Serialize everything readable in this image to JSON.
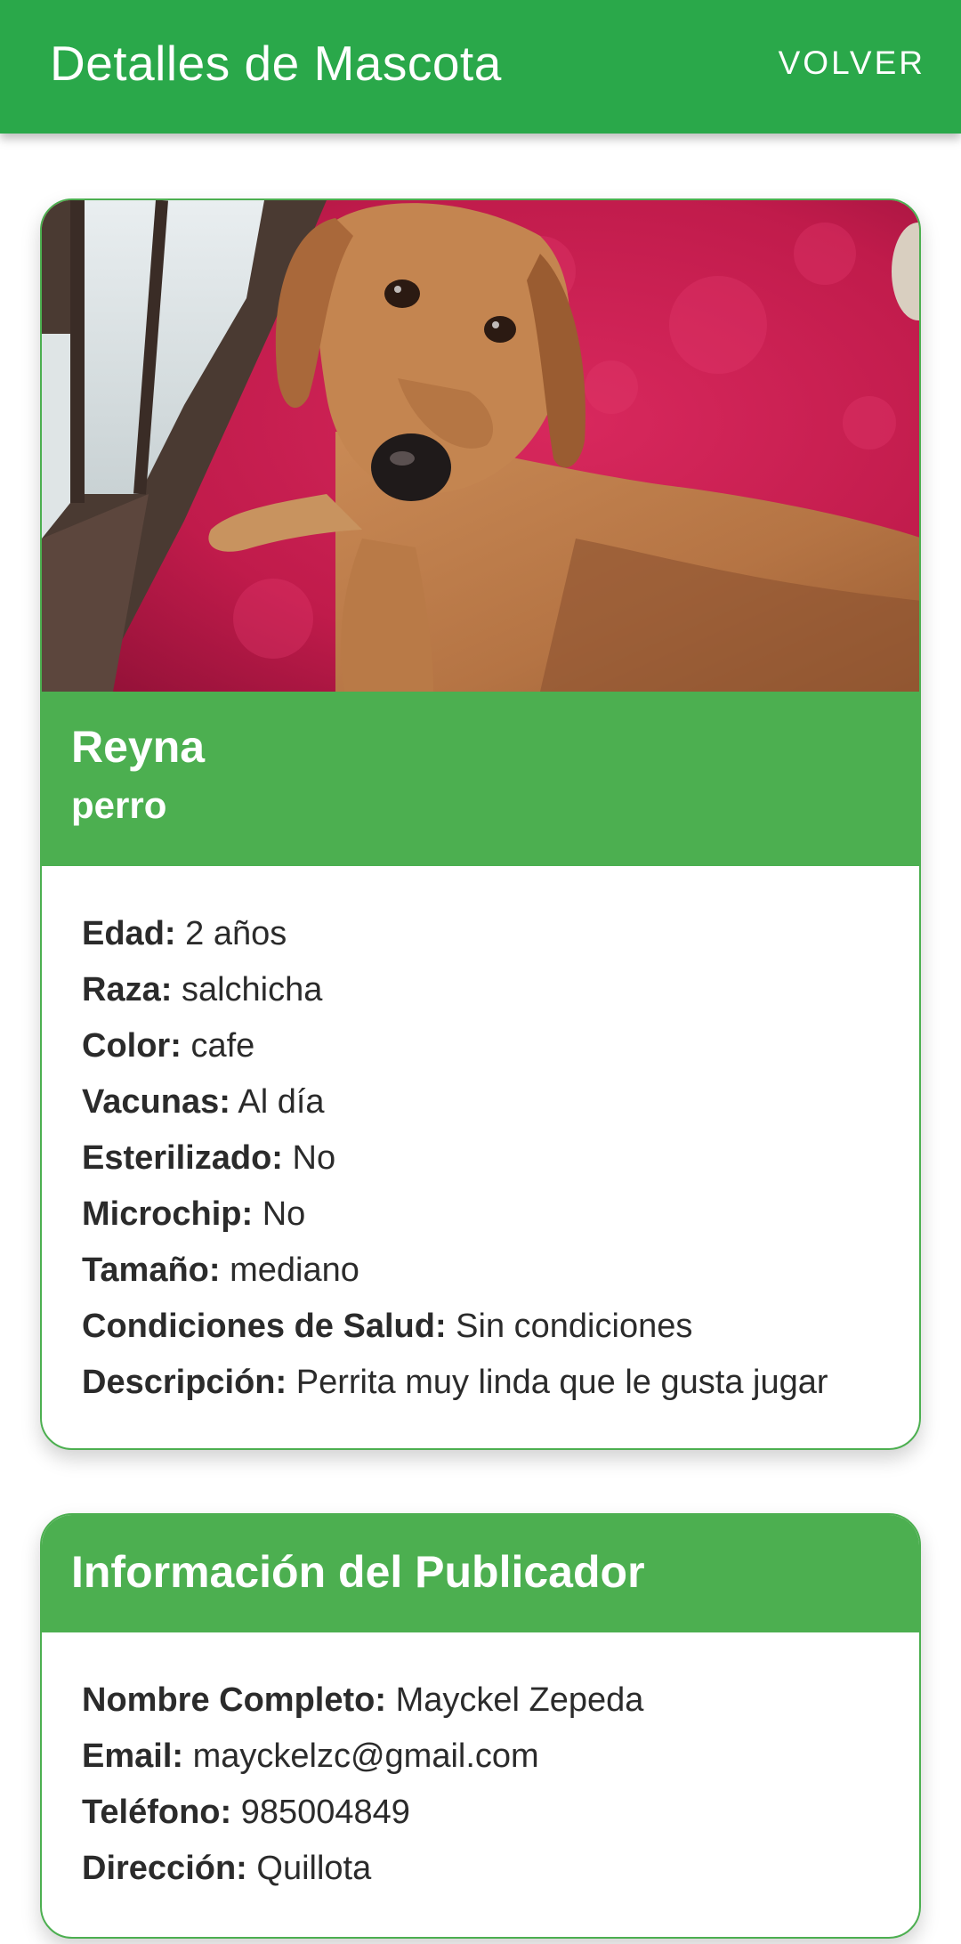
{
  "appbar": {
    "title": "Detalles de Mascota",
    "back_label": "VOLVER"
  },
  "pet": {
    "name": "Reyna",
    "species": "perro",
    "fields": [
      {
        "label": "Edad:",
        "value": "2 años"
      },
      {
        "label": "Raza:",
        "value": "salchicha"
      },
      {
        "label": "Color:",
        "value": "cafe"
      },
      {
        "label": "Vacunas:",
        "value": "Al día"
      },
      {
        "label": "Esterilizado:",
        "value": "No"
      },
      {
        "label": "Microchip:",
        "value": "No"
      },
      {
        "label": "Tamaño:",
        "value": "mediano"
      },
      {
        "label": "Condiciones de Salud:",
        "value": "Sin condiciones"
      },
      {
        "label": "Descripción:",
        "value": "Perrita muy linda que le gusta jugar"
      }
    ]
  },
  "owner": {
    "title": "Información del Publicador",
    "fields": [
      {
        "label": "Nombre Completo:",
        "value": "Mayckel Zepeda"
      },
      {
        "label": "Email:",
        "value": "mayckelzc@gmail.com"
      },
      {
        "label": "Teléfono:",
        "value": "985004849"
      },
      {
        "label": "Dirección:",
        "value": "Quillota"
      }
    ]
  },
  "colors": {
    "appbar": "#2aa84a",
    "card_header": "#4caf50",
    "card_border": "#4caf50"
  }
}
